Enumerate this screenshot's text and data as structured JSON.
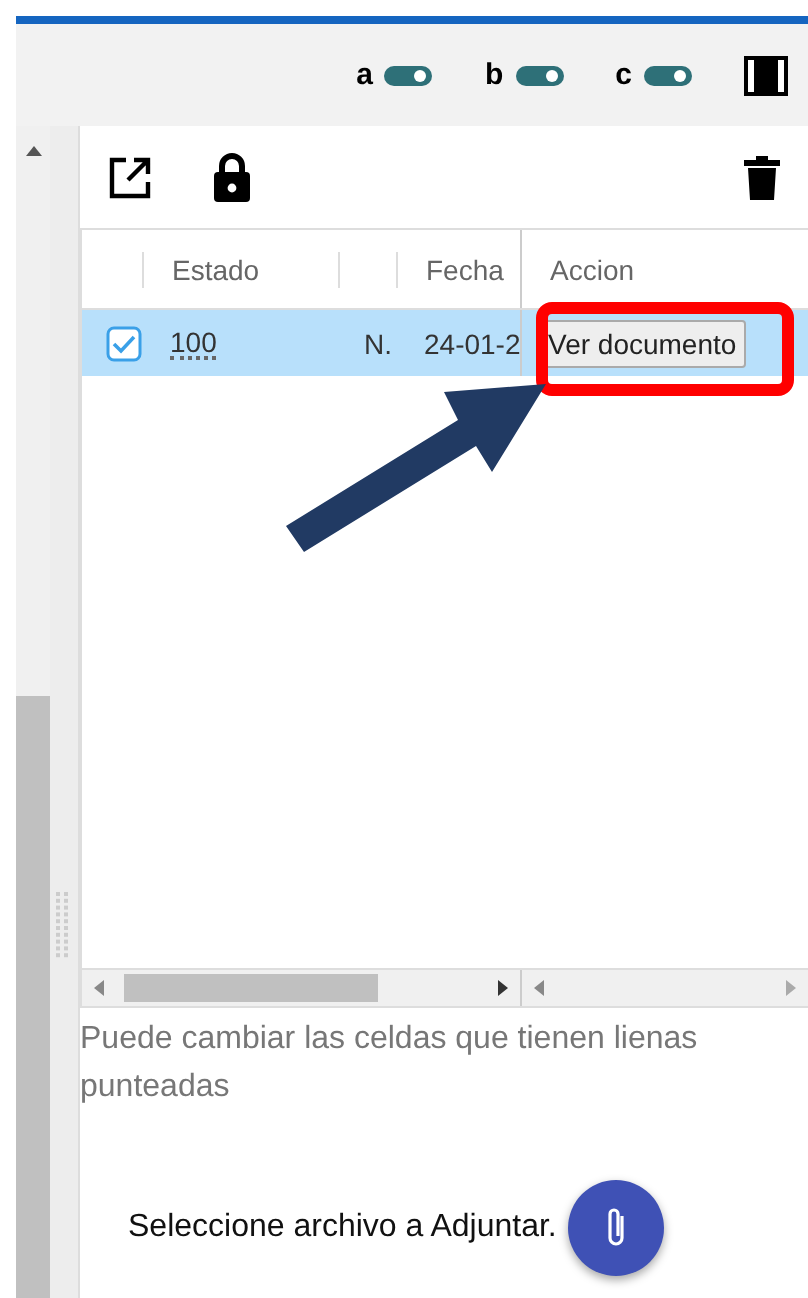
{
  "toolbar": {
    "toggles": [
      {
        "label": "a",
        "on": true
      },
      {
        "label": "b",
        "on": true
      },
      {
        "label": "c",
        "on": true
      }
    ]
  },
  "table": {
    "columns": [
      "Estado",
      "Fecha",
      "Accion"
    ],
    "rows": [
      {
        "selected": true,
        "checked": true,
        "estado": "100",
        "column_3": "N.",
        "fecha": "24-01-2",
        "accion": "Ver documento"
      }
    ]
  },
  "hint": "Puede cambiar las celdas que tienen lienas punteadas",
  "attach": {
    "label": "Seleccione archivo a Adjuntar."
  }
}
